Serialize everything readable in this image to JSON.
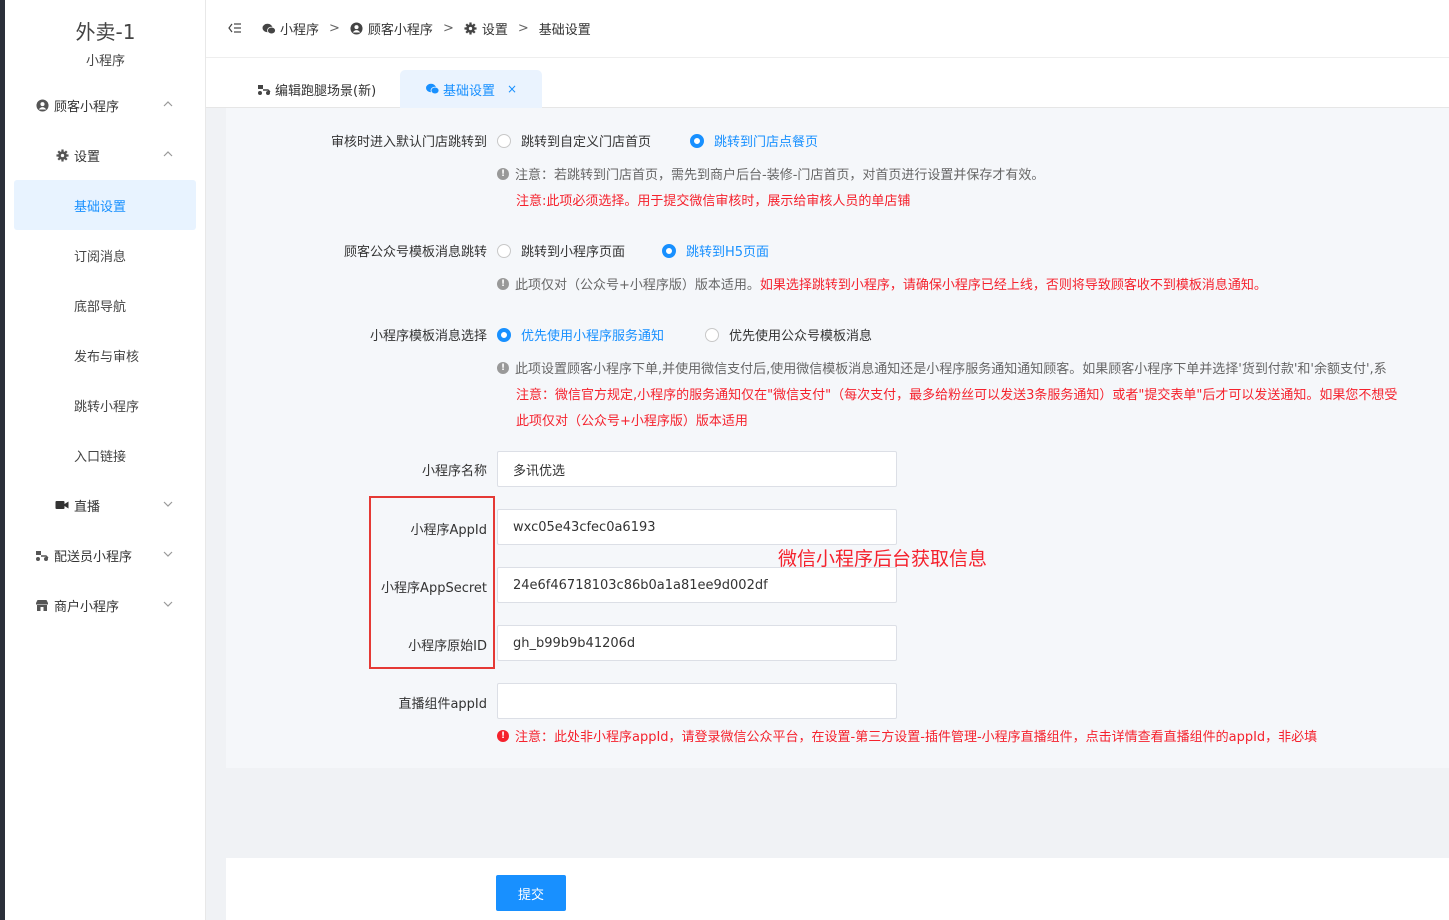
{
  "sidebar": {
    "brand_title": "外卖-1",
    "brand_subtitle": "小程序",
    "items": [
      {
        "label": "顾客小程序",
        "icon": "user-circle-icon",
        "expanded": true
      },
      {
        "label": "设置",
        "icon": "gear-icon",
        "expanded": true
      },
      {
        "label": "基础设置",
        "active": true
      },
      {
        "label": "订阅消息"
      },
      {
        "label": "底部导航"
      },
      {
        "label": "发布与审核"
      },
      {
        "label": "跳转小程序"
      },
      {
        "label": "入口链接"
      },
      {
        "label": "直播",
        "icon": "video-camera-icon"
      },
      {
        "label": "配送员小程序",
        "icon": "delivery-scooter-icon"
      },
      {
        "label": "商户小程序",
        "icon": "shop-icon"
      }
    ]
  },
  "breadcrumb": {
    "items": [
      "小程序",
      "顾客小程序",
      "设置",
      "基础设置"
    ],
    "separator": ">"
  },
  "tabs": [
    {
      "label": "编辑跑腿场景(新)",
      "icon": "delivery-scooter-icon",
      "active": false
    },
    {
      "label": "基础设置",
      "icon": "wechat-icon",
      "active": true,
      "close": "×"
    }
  ],
  "form": {
    "review_jump": {
      "label": "审核时进入默认门店跳转到",
      "options": [
        "跳转到自定义门店首页",
        "跳转到门店点餐页"
      ],
      "selected": 1,
      "note": "注意：若跳转到门店首页，需先到商户后台-装修-门店首页，对首页进行设置并保存才有效。",
      "warning": "注意:此项必须选择。用于提交微信审核时，展示给审核人员的单店铺"
    },
    "template_jump": {
      "label": "顾客公众号模板消息跳转",
      "options": [
        "跳转到小程序页面",
        "跳转到H5页面"
      ],
      "selected": 1,
      "note_gray": "此项仅对（公众号+小程序版）版本适用。",
      "note_red": "如果选择跳转到小程序，请确保小程序已经上线，否则将导致顾客收不到模板消息通知。"
    },
    "template_choice": {
      "label": "小程序模板消息选择",
      "options": [
        "优先使用小程序服务通知",
        "优先使用公众号模板消息"
      ],
      "selected": 0,
      "note": "此项设置顾客小程序下单,并使用微信支付后,使用微信模板消息通知还是小程序服务通知通知顾客。如果顾客小程序下单并选择'货到付款'和'余额支付',系",
      "warning1": "注意：微信官方规定,小程序的服务通知仅在\"微信支付\"（每次支付，最多给粉丝可以发送3条服务通知）或者\"提交表单\"后才可以发送通知。如果您不想受",
      "warning2": "此项仅对（公众号+小程序版）版本适用"
    },
    "name": {
      "label": "小程序名称",
      "value": "多讯优选"
    },
    "appid": {
      "label": "小程序AppId",
      "value": "wxc05e43cfec0a6193"
    },
    "appsecret": {
      "label": "小程序AppSecret",
      "value": "24e6f46718103c86b0a1a81ee9d002df"
    },
    "origin_id": {
      "label": "小程序原始ID",
      "value": "gh_b99b9b41206d"
    },
    "live_appid": {
      "label": "直播组件appId",
      "value": "",
      "error": "注意：此处非小程序appId，请登录微信公众平台，在设置-第三方设置-插件管理-小程序直播组件，点击详情查看直播组件的appId，非必填"
    },
    "annotation": "微信小程序后台获取信息",
    "submit_label": "提交"
  },
  "colors": {
    "primary": "#1890ff",
    "danger": "#f5222d",
    "annotation_box": "#e53935"
  }
}
